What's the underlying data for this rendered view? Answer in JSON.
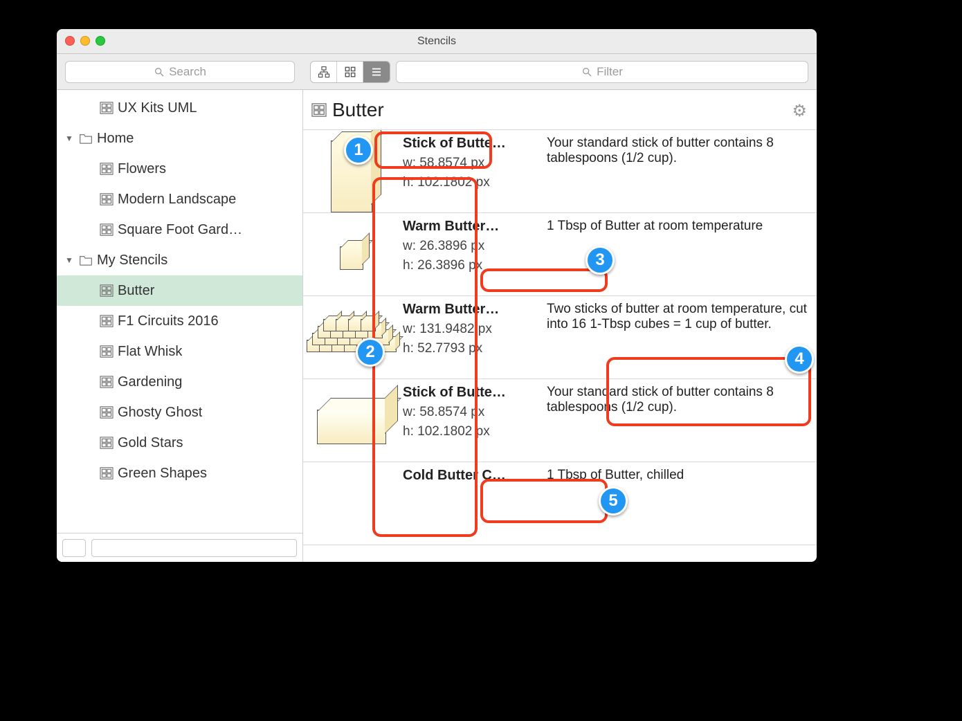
{
  "window": {
    "title": "Stencils"
  },
  "toolbar": {
    "search_placeholder": "Search",
    "filter_placeholder": "Filter"
  },
  "sidebar": {
    "items": [
      {
        "kind": "stencil",
        "label": "UX Kits UML",
        "depth": 2
      },
      {
        "kind": "folder",
        "label": "Home",
        "depth": 0,
        "expanded": true
      },
      {
        "kind": "stencil",
        "label": "Flowers",
        "depth": 2
      },
      {
        "kind": "stencil",
        "label": "Modern Landscape",
        "depth": 2
      },
      {
        "kind": "stencil",
        "label": "Square Foot Gard…",
        "depth": 2
      },
      {
        "kind": "folder",
        "label": "My Stencils",
        "depth": 0,
        "expanded": true
      },
      {
        "kind": "stencil",
        "label": "Butter",
        "depth": 2,
        "selected": true
      },
      {
        "kind": "stencil",
        "label": "F1 Circuits 2016",
        "depth": 2
      },
      {
        "kind": "stencil",
        "label": "Flat Whisk",
        "depth": 2
      },
      {
        "kind": "stencil",
        "label": "Gardening",
        "depth": 2
      },
      {
        "kind": "stencil",
        "label": "Ghosty Ghost",
        "depth": 2
      },
      {
        "kind": "stencil",
        "label": "Gold Stars",
        "depth": 2
      },
      {
        "kind": "stencil",
        "label": "Green Shapes",
        "depth": 2
      }
    ]
  },
  "content": {
    "title": "Butter",
    "items": [
      {
        "name": "Stick of Butte…",
        "w": "w: 58.8574 px",
        "h": "h: 102.1802 px",
        "desc": "Your standard stick of butter contains 8 tablespoons (1/2 cup).",
        "shape": "tall"
      },
      {
        "name": "Warm Butter…",
        "w": "w: 26.3896 px",
        "h": "h: 26.3896 px",
        "desc": "1 Tbsp of Butter at room temperature",
        "shape": "cube"
      },
      {
        "name": "Warm Butter…",
        "w": "w: 131.9482 px",
        "h": "h: 52.7793 px",
        "desc": "Two sticks of butter at room temperature, cut into 16 1-Tbsp cubes = 1 cup of butter.",
        "shape": "grid"
      },
      {
        "name": "Stick of Butte…",
        "w": "w: 58.8574 px",
        "h": "h: 102.1802 px",
        "desc": "Your standard stick of butter contains 8 tablespoons (1/2 cup).",
        "shape": "wide"
      },
      {
        "name": "Cold Butter C…",
        "w": "",
        "h": "",
        "desc": "1 Tbsp of Butter, chilled",
        "shape": ""
      }
    ]
  },
  "callouts": [
    "1",
    "2",
    "3",
    "4",
    "5"
  ]
}
